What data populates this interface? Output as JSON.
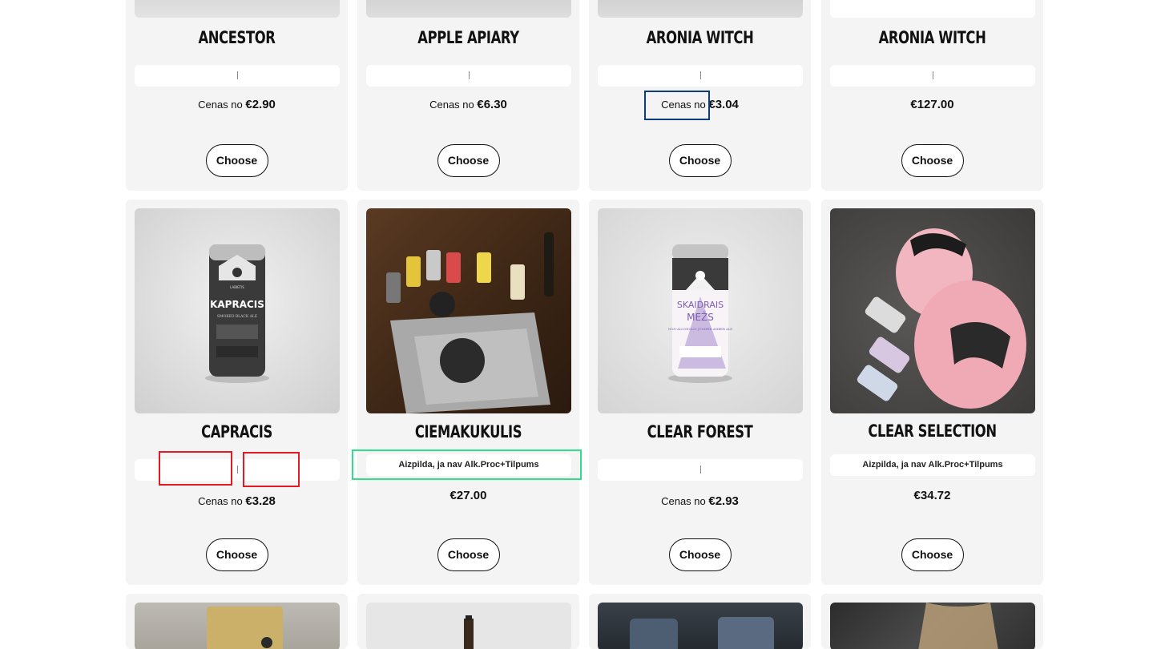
{
  "products": [
    {
      "name": "ANCESTOR",
      "selector": "|",
      "price_prefix": "Cenas no ",
      "price": "€2.90",
      "button": "Choose",
      "image": "product-top-cropped"
    },
    {
      "name": "APPLE APIARY",
      "selector": "|",
      "price_prefix": "Cenas no ",
      "price": "€6.30",
      "button": "Choose",
      "image": "product-top-cropped"
    },
    {
      "name": "ARONIA WITCH",
      "selector": "|",
      "price_prefix": "Cenas no ",
      "price": "€3.04",
      "button": "Choose",
      "image": "product-top-cropped"
    },
    {
      "name": "ARONIA WITCH",
      "selector": "|",
      "price_prefix": "",
      "price": "€127.00",
      "button": "Choose",
      "image": "product-top-cropped"
    },
    {
      "name": "CAPRACIS",
      "selector": "|",
      "price_prefix": "Cenas no ",
      "price": "€3.28",
      "button": "Choose",
      "image": "can-kapracis"
    },
    {
      "name": "CIEMAKUKULIS",
      "selector": "Aizpilda, ja nav Alk.Proc+Tilpums",
      "price_prefix": "",
      "price": "€27.00",
      "button": "Choose",
      "image": "gift-set-photo"
    },
    {
      "name": "CLEAR FOREST",
      "selector": "|",
      "price_prefix": "Cenas no ",
      "price": "€2.93",
      "button": "Choose",
      "image": "can-skaidrais-mezs"
    },
    {
      "name": "CLEAR SELECTION",
      "selector": "Aizpilda, ja nav Alk.Proc+Tilpums",
      "price_prefix": "",
      "price": "€34.72",
      "button": "Choose",
      "image": "inflatable-doll-photo"
    }
  ],
  "bottom_row_images": [
    "coffee-bag-photo",
    "bottle-photo",
    "bags-photo",
    "person-photo"
  ],
  "can_labels": {
    "brand": "LABIETIS",
    "kapracis_title": "KAPRACIS",
    "kapracis_sub": "SMOKED BLACK ALE",
    "mezs_title_1": "SKAIDRAIS",
    "mezs_title_2": "MEŽS",
    "mezs_sub": "NON-ALCOHOLIC JUNIPER AMBER ALE"
  },
  "colors": {
    "card_bg": "#f4f4f4",
    "highlight_red": "#e01b24",
    "highlight_green": "#2ee08a",
    "highlight_blue": "#0c3f7a"
  }
}
